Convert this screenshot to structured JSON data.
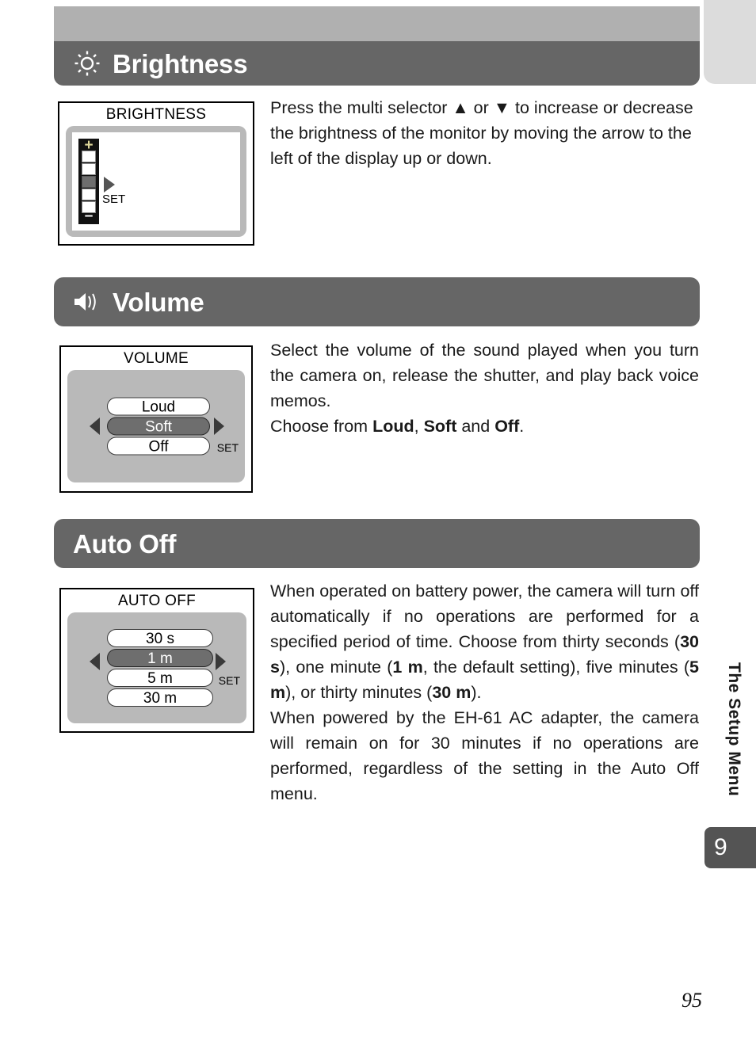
{
  "page": {
    "number": "95",
    "side_tab_label": "The Setup Menu",
    "side_tab_badge": "9"
  },
  "sections": [
    {
      "id": "brightness",
      "title": "Brightness",
      "icon": "sun-brightness-icon",
      "lcd": {
        "caption": "BRIGHTNESS",
        "type": "slider",
        "plus_label": "+",
        "minus_label": "–",
        "set_label": "SET",
        "cells": 5,
        "selected_cell_index": 2
      },
      "text": "Press the multi selector ▲ or ▼ to increase or decrease the brightness of the monitor by moving the arrow to the left of the display up or down."
    },
    {
      "id": "volume",
      "title": "Volume",
      "icon": "speaker-volume-icon",
      "lcd": {
        "caption": "VOLUME",
        "type": "list",
        "set_label": "SET",
        "options": [
          "Loud",
          "Soft",
          "Off"
        ],
        "selected": "Soft"
      },
      "text_paragraph_1": "Select the volume of the sound played when you turn the camera on, release the shutter, and play back voice memos.",
      "text_paragraph_2_prefix": "Choose from ",
      "text_paragraph_2_bold_1": "Loud",
      "text_paragraph_2_mid_1": ", ",
      "text_paragraph_2_bold_2": "Soft",
      "text_paragraph_2_mid_2": " and ",
      "text_paragraph_2_bold_3": "Off",
      "text_paragraph_2_suffix": "."
    },
    {
      "id": "autooff",
      "title": "Auto Off",
      "icon": "none",
      "lcd": {
        "caption": "AUTO OFF",
        "type": "list",
        "set_label": "SET",
        "options": [
          "30 s",
          "1 m",
          "5 m",
          "30 m"
        ],
        "selected": "1 m"
      },
      "text_p1_a": "When operated on battery power, the camera will turn off automatically if no operations are performed for a specified period of time. Choose from thirty seconds (",
      "text_p1_b1": "30 s",
      "text_p1_b": "), one minute (",
      "text_p1_b2": "1 m",
      "text_p1_c": ", the default setting), five minutes (",
      "text_p1_b3": "5 m",
      "text_p1_d": "), or thirty minutes (",
      "text_p1_b4": "30 m",
      "text_p1_e": ").",
      "text_p2": "When powered by the EH-61 AC adapter, the camera will remain on for 30 minutes if no operations are performed, regardless of the setting in the Auto Off menu."
    }
  ],
  "colors": {
    "header_bar": "#666666",
    "top_band": "#b0b0b0",
    "corner_tab": "#dcdcdc",
    "lcd_screen": "#b9b9b9",
    "selected_option": "#6e6e6e",
    "badge": "#545454"
  }
}
